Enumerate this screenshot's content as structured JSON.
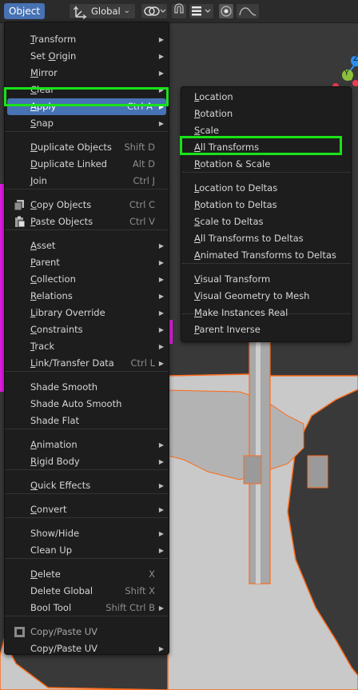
{
  "header": {
    "object_menu_label": "Object",
    "orientation_label": "Global"
  },
  "main_menu": {
    "items": [
      {
        "label": "Transform",
        "shortcut": "",
        "submenu": true
      },
      {
        "label": "Set Origin",
        "shortcut": "",
        "submenu": true
      },
      {
        "label": "Mirror",
        "shortcut": "",
        "submenu": true
      },
      {
        "label": "Clear",
        "shortcut": "",
        "submenu": true
      },
      {
        "label": "Apply",
        "shortcut": "Ctrl A",
        "submenu": true,
        "active": true
      },
      {
        "label": "Snap",
        "shortcut": "",
        "submenu": true
      },
      {
        "label": "Duplicate Objects",
        "shortcut": "Shift D"
      },
      {
        "label": "Duplicate Linked",
        "shortcut": "Alt D"
      },
      {
        "label": "Join",
        "shortcut": "Ctrl J"
      },
      {
        "label": "Copy Objects",
        "shortcut": "Ctrl C",
        "icon": "copy-icon"
      },
      {
        "label": "Paste Objects",
        "shortcut": "Ctrl V",
        "icon": "paste-icon"
      },
      {
        "label": "Asset",
        "shortcut": "",
        "submenu": true
      },
      {
        "label": "Parent",
        "shortcut": "",
        "submenu": true
      },
      {
        "label": "Collection",
        "shortcut": "",
        "submenu": true
      },
      {
        "label": "Relations",
        "shortcut": "",
        "submenu": true
      },
      {
        "label": "Library Override",
        "shortcut": "",
        "submenu": true
      },
      {
        "label": "Constraints",
        "shortcut": "",
        "submenu": true
      },
      {
        "label": "Track",
        "shortcut": "",
        "submenu": true
      },
      {
        "label": "Link/Transfer Data",
        "shortcut": "Ctrl L",
        "submenu": true
      },
      {
        "label": "Shade Smooth",
        "shortcut": ""
      },
      {
        "label": "Shade Auto Smooth",
        "shortcut": ""
      },
      {
        "label": "Shade Flat",
        "shortcut": ""
      },
      {
        "label": "Animation",
        "shortcut": "",
        "submenu": true
      },
      {
        "label": "Rigid Body",
        "shortcut": "",
        "submenu": true
      },
      {
        "label": "Quick Effects",
        "shortcut": "",
        "submenu": true
      },
      {
        "label": "Convert",
        "shortcut": "",
        "submenu": true
      },
      {
        "label": "Show/Hide",
        "shortcut": "",
        "submenu": true
      },
      {
        "label": "Clean Up",
        "shortcut": "",
        "submenu": true
      },
      {
        "label": "Delete",
        "shortcut": "X"
      },
      {
        "label": "Delete Global",
        "shortcut": "Shift X"
      },
      {
        "label": "Bool Tool",
        "shortcut": "Shift Ctrl B",
        "submenu": true
      },
      {
        "label": "Copy/Paste UV",
        "shortcut": "",
        "icon": "uv-icon",
        "disabled": true
      },
      {
        "label": "Copy/Paste UV",
        "shortcut": "",
        "submenu": true
      }
    ]
  },
  "apply_submenu": {
    "items": [
      {
        "label": "Location"
      },
      {
        "label": "Rotation"
      },
      {
        "label": "Scale"
      },
      {
        "label": "All Transforms",
        "highlighted": true
      },
      {
        "label": "Rotation & Scale"
      },
      {
        "label": "Location to Deltas"
      },
      {
        "label": "Rotation to Deltas"
      },
      {
        "label": "Scale to Deltas"
      },
      {
        "label": "All Transforms to Deltas"
      },
      {
        "label": "Animated Transforms to Deltas"
      },
      {
        "label": "Visual Transform"
      },
      {
        "label": "Visual Geometry to Mesh"
      },
      {
        "label": "Make Instances Real"
      },
      {
        "label": "Parent Inverse"
      }
    ]
  },
  "gizmo": {
    "y_axis_label": "Y",
    "z_axis_label": "Z",
    "y_color": "#8bc13a",
    "z_color": "#2b8ff0",
    "x_color": "#f03a4f"
  },
  "colors": {
    "accent": "#4772b3",
    "highlight_box": "#18e318",
    "selection_outline": "#ff6a1a",
    "magenta_object": "#e31ce3"
  }
}
